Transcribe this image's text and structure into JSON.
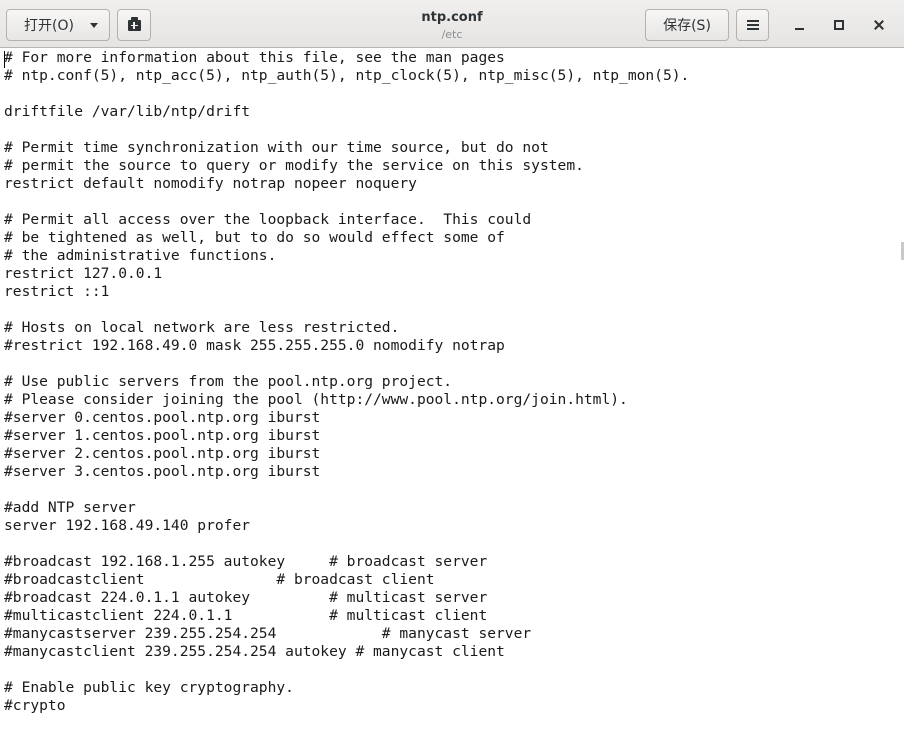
{
  "header": {
    "open_label": "打开(O)",
    "title": "ntp.conf",
    "subtitle": "/etc",
    "save_label": "保存(S)"
  },
  "editor": {
    "lines": [
      "# For more information about this file, see the man pages",
      "# ntp.conf(5), ntp_acc(5), ntp_auth(5), ntp_clock(5), ntp_misc(5), ntp_mon(5).",
      "",
      "driftfile /var/lib/ntp/drift",
      "",
      "# Permit time synchronization with our time source, but do not",
      "# permit the source to query or modify the service on this system.",
      "restrict default nomodify notrap nopeer noquery",
      "",
      "# Permit all access over the loopback interface.  This could",
      "# be tightened as well, but to do so would effect some of",
      "# the administrative functions.",
      "restrict 127.0.0.1",
      "restrict ::1",
      "",
      "# Hosts on local network are less restricted.",
      "#restrict 192.168.49.0 mask 255.255.255.0 nomodify notrap",
      "",
      "# Use public servers from the pool.ntp.org project.",
      "# Please consider joining the pool (http://www.pool.ntp.org/join.html).",
      "#server 0.centos.pool.ntp.org iburst",
      "#server 1.centos.pool.ntp.org iburst",
      "#server 2.centos.pool.ntp.org iburst",
      "#server 3.centos.pool.ntp.org iburst",
      "",
      "#add NTP server",
      "server 192.168.49.140 profer",
      "",
      "#broadcast 192.168.1.255 autokey     # broadcast server",
      "#broadcastclient               # broadcast client",
      "#broadcast 224.0.1.1 autokey         # multicast server",
      "#multicastclient 224.0.1.1           # multicast client",
      "#manycastserver 239.255.254.254            # manycast server",
      "#manycastclient 239.255.254.254 autokey # manycast client",
      "",
      "# Enable public key cryptography.",
      "#crypto"
    ]
  }
}
